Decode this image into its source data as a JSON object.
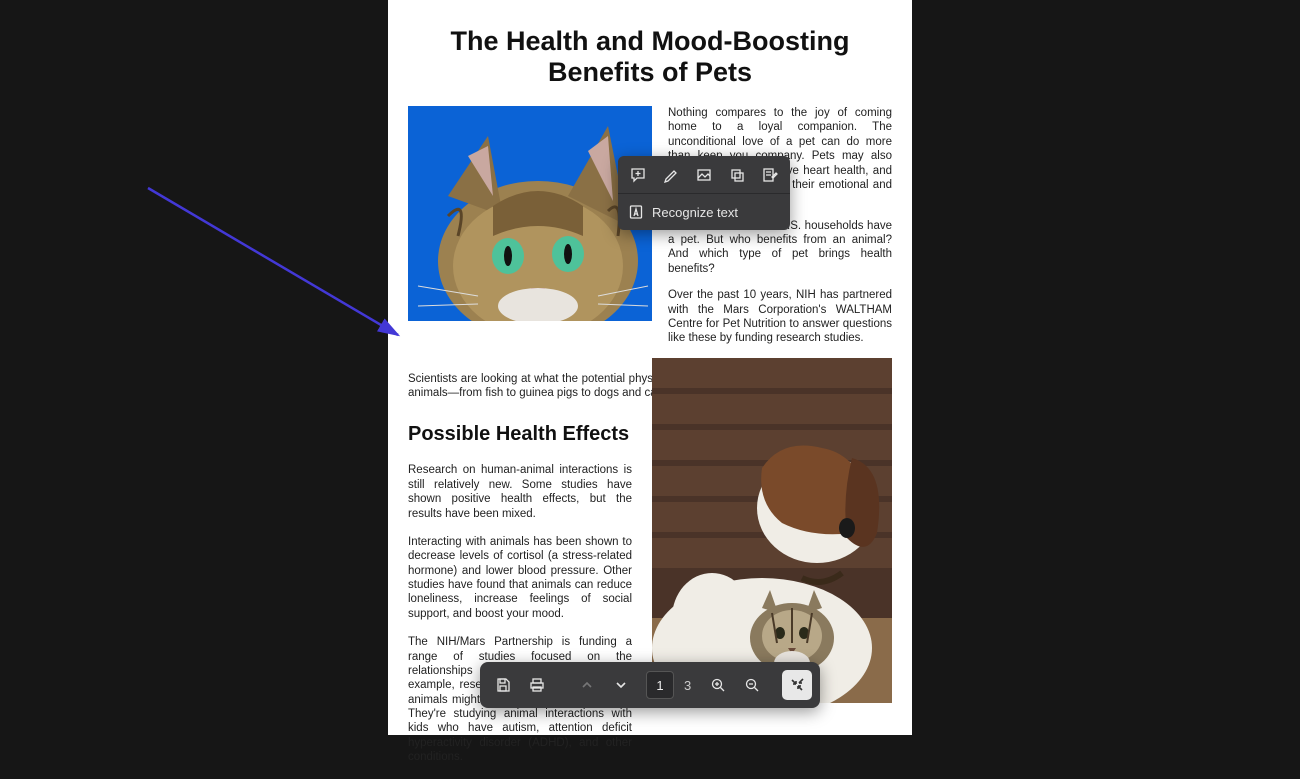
{
  "document": {
    "title": "The Health and Mood-Boosting Benefits of Pets",
    "para1": "Nothing compares to the joy of coming home to a loyal companion. The unconditional love of a pet can do more than keep you company. Pets may also decrease stress, improve heart health, and even help children with their emotional and social skills.",
    "para2": "An estimated 68% of U.S. households have a pet. But who benefits from an animal? And which type of pet brings health benefits?",
    "para3": "Over the past 10 years, NIH has partnered with the Mars Corporation's WALTHAM Centre for Pet Nutrition to answer questions like these by funding research studies.",
    "para4": "Scientists are looking at what the potential physical and mental health benefits are for different animals—from fish to guinea pigs to dogs and cats.",
    "heading2": "Possible Health Effects",
    "para5": "Research on human-animal interactions is still relatively new. Some studies have shown positive health effects, but the results have been mixed.",
    "para6": "Interacting with animals has been shown to decrease levels of cortisol (a stress-related hormone) and lower blood pressure. Other studies have found that animals can reduce loneliness, increase feelings of social support, and boost your mood.",
    "para7": "The NIH/Mars Partnership is funding a range of studies focused on the relationships we have with animals. For example, researchers are looking into how animals might influence child development. They're studying animal interactions with kids who have autism, attention deficit hyperactivity disorder (ADHD), and other conditions."
  },
  "context_menu": {
    "recognize_text": "Recognize text"
  },
  "viewer": {
    "current_page": "1",
    "total_pages": "3"
  },
  "colors": {
    "arrow": "#4338d6"
  }
}
